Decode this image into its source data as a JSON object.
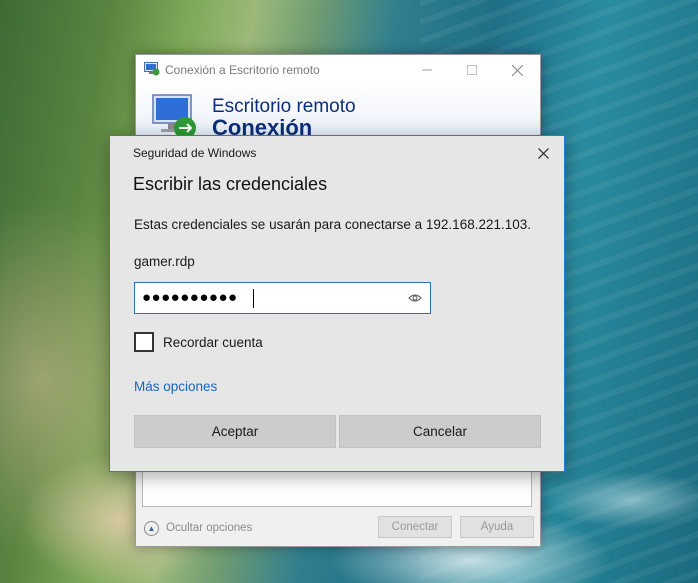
{
  "rdp_window": {
    "title": "Conexión a Escritorio remoto",
    "banner_line1": "Escritorio remoto",
    "banner_line2": "Conexión",
    "hide_options_label": "Ocultar opciones",
    "connect_label": "Conectar",
    "help_label": "Ayuda",
    "icons": {
      "app": "remote-desktop-icon",
      "minimize": "minimize-icon",
      "maximize": "maximize-icon",
      "close": "close-icon",
      "hide_options": "chevron-up-icon"
    }
  },
  "security_dialog": {
    "title": "Seguridad de Windows",
    "heading": "Escribir las credenciales",
    "description": "Estas credenciales se usarán para conectarse a 192.168.221.103.",
    "username": "gamer.rdp",
    "password_masked": "●●●●●●●●●●",
    "remember_label": "Recordar cuenta",
    "remember_checked": false,
    "more_options": "Más opciones",
    "accept_label": "Aceptar",
    "cancel_label": "Cancelar",
    "icons": {
      "close": "close-icon",
      "reveal": "eye-icon"
    },
    "accent_color": "#1f7fd6",
    "link_color": "#1766c2"
  }
}
